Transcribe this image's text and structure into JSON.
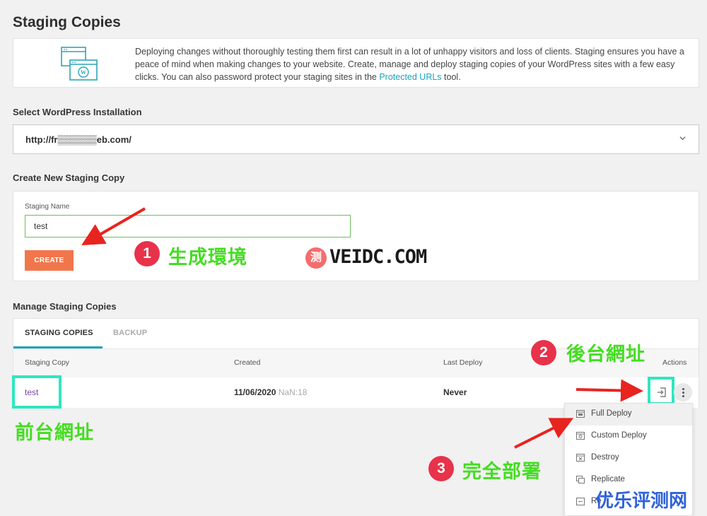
{
  "page": {
    "title": "Staging Copies"
  },
  "intro": {
    "text_before_link": "Deploying changes without thoroughly testing them first can result in a lot of unhappy visitors and loss of clients. Staging ensures you have a peace of mind when making changes to your website. Create, manage and deploy staging copies of your WordPress sites with a few easy clicks. You can also password protect your staging sites in the ",
    "link_text": "Protected URLs",
    "text_after_link": " tool.",
    "link_color": "#1aa3b9"
  },
  "installation": {
    "label": "Select WordPress Installation",
    "selected": "http://fr▒▒▒▒▒▒eb.com/"
  },
  "create": {
    "section_label": "Create New Staging Copy",
    "field_label": "Staging Name",
    "field_value": "test",
    "button_label": "CREATE",
    "button_color": "#f2764b"
  },
  "manage": {
    "section_label": "Manage Staging Copies",
    "tabs": [
      {
        "label": "STAGING COPIES",
        "active": true
      },
      {
        "label": "BACKUP",
        "active": false
      }
    ],
    "columns": [
      "Staging Copy",
      "Created",
      "Last Deploy",
      "Actions"
    ],
    "rows": [
      {
        "name": "test",
        "created_date": "11/06/2020",
        "created_time": "NaN:18",
        "last_deploy": "Never"
      }
    ]
  },
  "actions_menu": {
    "items": [
      {
        "label": "Full Deploy",
        "icon": "full-deploy-icon"
      },
      {
        "label": "Custom Deploy",
        "icon": "custom-deploy-icon"
      },
      {
        "label": "Destroy",
        "icon": "destroy-icon"
      },
      {
        "label": "Replicate",
        "icon": "replicate-icon"
      },
      {
        "label": "Re",
        "icon": "rename-icon"
      }
    ]
  },
  "annotations": {
    "step1_number": "1",
    "step1_text": "生成環境",
    "step2_number": "2",
    "step2_text": "後台網址",
    "step3_number": "3",
    "step3_text": "完全部署",
    "frontend_text": "前台網址",
    "highlight_color": "#2fe6c1",
    "label_color": "#44dd22",
    "arrow_color": "#e8241f"
  },
  "watermarks": {
    "logo_char": "测",
    "site": "VEIDC.COM",
    "brand": "优乐评测网"
  }
}
